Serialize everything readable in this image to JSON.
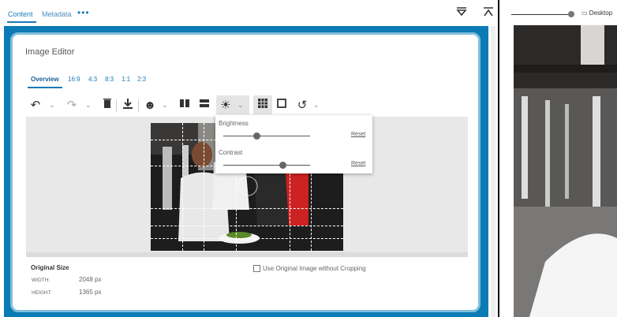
{
  "tabs": {
    "content": "Content",
    "metadata": "Metadata",
    "more": "•••"
  },
  "top_buttons": {
    "collapse_icon": "⩔",
    "expand_icon": "⌅"
  },
  "editor": {
    "title": "Image Editor",
    "aspect_tabs": [
      "Overview",
      "16:9",
      "4:3",
      "8:3",
      "1:1",
      "2:3"
    ],
    "active_tab": "Overview"
  },
  "toolbar": {
    "undo": "↶",
    "redo": "↷",
    "delete": "🗑",
    "download": "⤓",
    "face": "☻",
    "split_v": "▮▮",
    "split_h": "▬",
    "brightness": "☀",
    "grid": "▦",
    "crop": "□",
    "rotate": "↺",
    "chevron": "⌄"
  },
  "adjust_popup": {
    "brightness_label": "Brightness",
    "brightness_value": 0.38,
    "contrast_label": "Contrast",
    "contrast_value": 0.68,
    "reset_label": "Reset"
  },
  "original_size": {
    "title": "Original Size",
    "width_label": "WIDTH:",
    "width_value": "2048 px",
    "height_label": "HEIGHT:",
    "height_value": "1365 px"
  },
  "crop_option": {
    "label": "Use Original Image without Cropping",
    "checked": false
  },
  "preview": {
    "device_label": "Desktop",
    "zoom_value": 0.95
  },
  "colors": {
    "accent": "#1a7ab8",
    "frame": "#0a7bb5",
    "frame_border": "#7fbfdd"
  }
}
